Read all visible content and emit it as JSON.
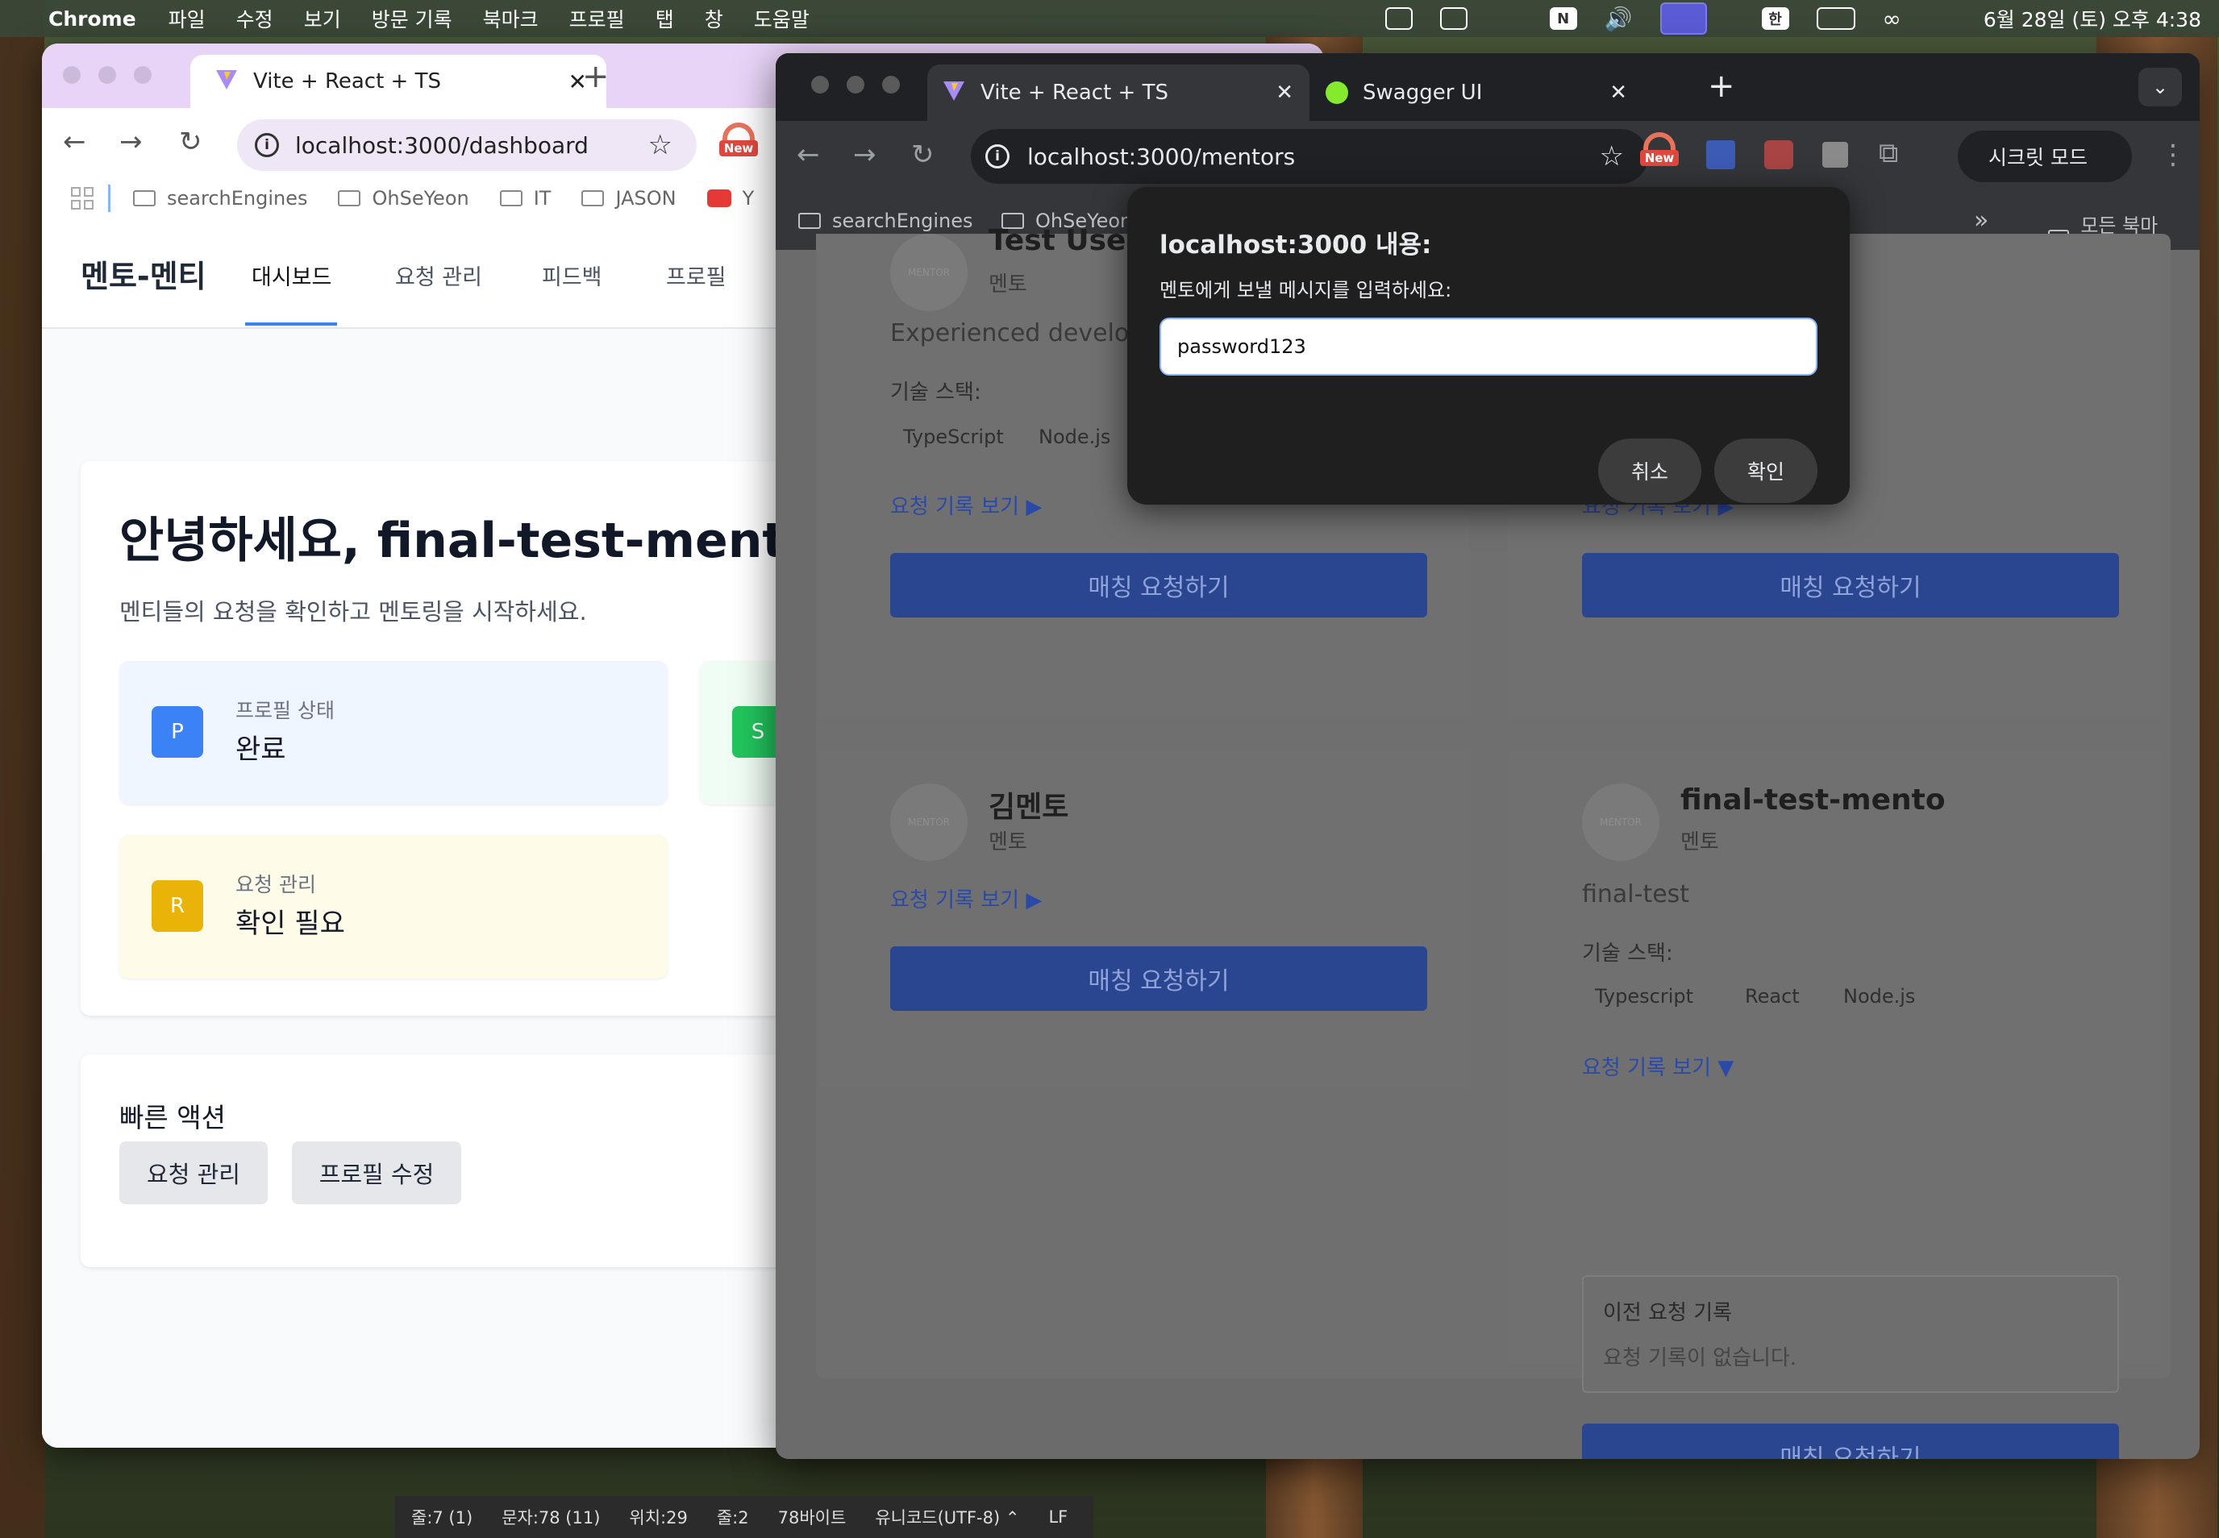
{
  "menubar": {
    "app": "Chrome",
    "items": [
      "파일",
      "수정",
      "보기",
      "방문 기록",
      "북마크",
      "프로필",
      "탭",
      "창",
      "도움말"
    ],
    "input_indicator": "한",
    "clock": "6월 28일 (토) 오후 4:38"
  },
  "window1": {
    "tab_title": "Vite + React + TS",
    "url": "localhost:3000/dashboard",
    "new_badge": "New",
    "bookmarks": [
      "searchEngines",
      "OhSeYeon",
      "IT",
      "JASON",
      "Y"
    ],
    "app": {
      "brand": "멘토-멘티",
      "nav": [
        "대시보드",
        "요청 관리",
        "피드백",
        "프로필"
      ],
      "greeting": "안녕하세요, final-test-mento님!",
      "subtitle": "멘티들의 요청을 확인하고 멘토링을 시작하세요.",
      "stats": [
        {
          "badge": "P",
          "label": "프로필 상태",
          "value": "완료",
          "color": "#3b82f6",
          "bg": "#eff6ff"
        },
        {
          "badge": "S",
          "label": "",
          "value": "",
          "color": "#22c55e",
          "bg": "#f0fdf4"
        },
        {
          "badge": "R",
          "label": "요청 관리",
          "value": "확인 필요",
          "color": "#eab308",
          "bg": "#fefce8"
        }
      ],
      "quick_actions_title": "빠른 액션",
      "quick_actions": [
        "요청 관리",
        "프로필 수정"
      ]
    }
  },
  "window2": {
    "tabs": [
      "Vite + React + TS",
      "Swagger UI"
    ],
    "url": "localhost:3000/mentors",
    "new_badge": "New",
    "incognito": "시크릿 모드",
    "bookmarks": [
      "searchEngines",
      "OhSeYeon"
    ],
    "all_bookmarks": "모든 북마크",
    "overflow": "»",
    "mentors": [
      {
        "avatar": "MENTOR",
        "name": "Test User",
        "role": "멘토",
        "bio": "Experienced developer",
        "skills_label": "기술 스택:",
        "skills": [
          "TypeScript",
          "Node.js"
        ],
        "history_link": "요청 기록 보기 ▶",
        "button": "매칭 요청하기"
      },
      {
        "avatar": "MENTOR",
        "name": "",
        "role": "",
        "history_link": "요청 기록 보기 ▶",
        "button": "매칭 요청하기"
      },
      {
        "avatar": "MENTOR",
        "name": "김멘토",
        "role": "멘토",
        "history_link": "요청 기록 보기 ▶",
        "button": "매칭 요청하기"
      },
      {
        "avatar": "MENTOR",
        "name": "final-test-mento",
        "role": "멘토",
        "bio": "final-test",
        "skills_label": "기술 스택:",
        "skills": [
          "Typescript",
          "React",
          "Node.js"
        ],
        "history_link": "요청 기록 보기 ▼",
        "history_title": "이전 요청 기록",
        "history_empty": "요청 기록이 없습니다.",
        "button": "매칭 요청하기"
      }
    ],
    "dialog": {
      "title": "localhost:3000 내용:",
      "message": "멘토에게 보낼 메시지를 입력하세요:",
      "input_value": "password123",
      "cancel": "취소",
      "ok": "확인"
    }
  },
  "statusbar": {
    "line": "줄:7 (1)",
    "chars": "문자:78 (11)",
    "position": "위치:29",
    "col": "줄:2",
    "size": "78바이트",
    "encoding": "유니코드(UTF-8) ⌃",
    "eol": "LF"
  }
}
